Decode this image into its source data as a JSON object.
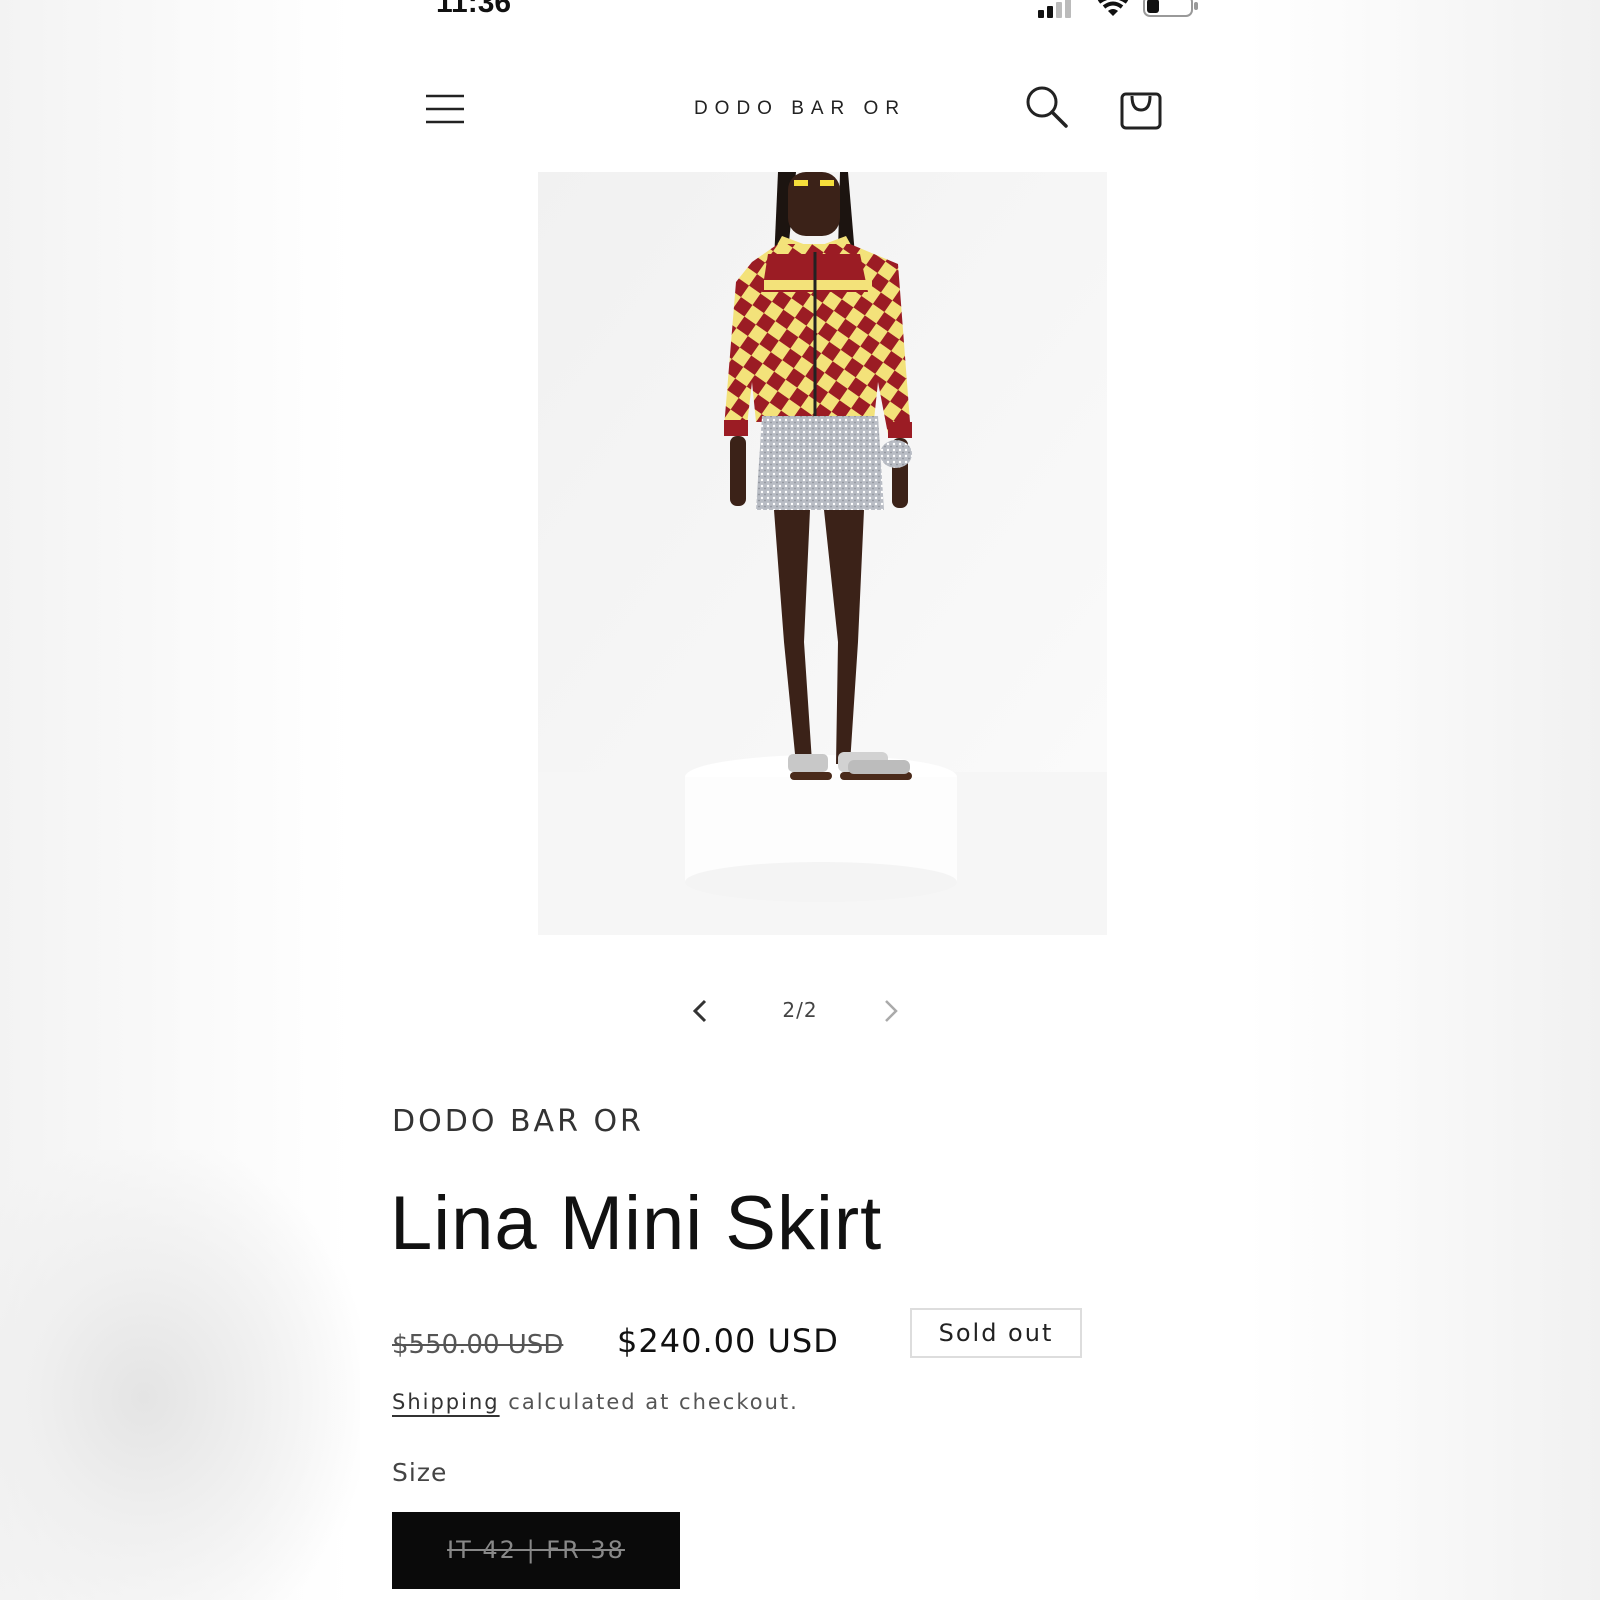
{
  "status_bar": {
    "time": "11:36"
  },
  "header": {
    "brand": "DODO BAR OR",
    "icons": [
      "menu-icon",
      "search-icon",
      "cart-icon"
    ]
  },
  "gallery": {
    "counter": "2/2",
    "current_slide": 2,
    "total_slides": 2
  },
  "product": {
    "vendor": "DODO BAR OR",
    "title": "Lina Mini Skirt",
    "price_original": "$550.00 USD",
    "price_sale": "$240.00 USD",
    "badge": "Sold out",
    "shipping_link": "Shipping",
    "shipping_text": " calculated at checkout.",
    "size_label": "Size",
    "size_options": [
      "IT 42 | FR 38"
    ]
  },
  "colors": {
    "text": "#111111",
    "muted": "#555555",
    "size_button_bg": "#0a0a0a",
    "jacket_red": "#9b1c24",
    "jacket_yellow": "#f3e27a"
  }
}
